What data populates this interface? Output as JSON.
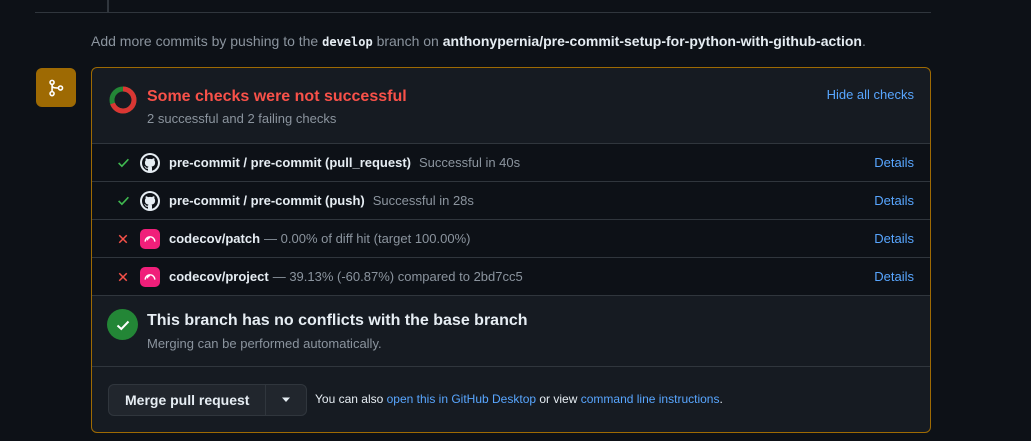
{
  "push_hint": {
    "prefix": "Add more commits by pushing to the ",
    "branch": "develop",
    "middle": " branch on ",
    "repo": "anthonypernia/pre-commit-setup-for-python-with-github-action",
    "suffix": "."
  },
  "checks_summary": {
    "title": "Some checks were not successful",
    "subtitle": "2 successful and 2 failing checks",
    "hide_label": "Hide all checks"
  },
  "checks": [
    {
      "status": "success",
      "app": "github-icon",
      "name": "pre-commit / pre-commit (pull_request)",
      "description": "Successful in 40s",
      "details_label": "Details"
    },
    {
      "status": "success",
      "app": "github-icon",
      "name": "pre-commit / pre-commit (push)",
      "description": "Successful in 28s",
      "details_label": "Details"
    },
    {
      "status": "failure",
      "app": "codecov-icon",
      "name": "codecov/patch",
      "description": "— 0.00% of diff hit (target 100.00%)",
      "details_label": "Details"
    },
    {
      "status": "failure",
      "app": "codecov-icon",
      "name": "codecov/project",
      "description": "— 39.13% (-60.87%) compared to 2bd7cc5",
      "details_label": "Details"
    }
  ],
  "conflicts": {
    "title": "This branch has no conflicts with the base branch",
    "subtitle": "Merging can be performed automatically."
  },
  "merge": {
    "button_label": "Merge pull request",
    "alt_prefix": "You can also ",
    "desktop_link": "open this in GitHub Desktop",
    "alt_middle": " or view ",
    "cli_link": "command line instructions",
    "alt_suffix": "."
  },
  "colors": {
    "warning_border": "#9e6a03",
    "failure": "#f85149",
    "success": "#3fb950",
    "link": "#58a6ff"
  }
}
